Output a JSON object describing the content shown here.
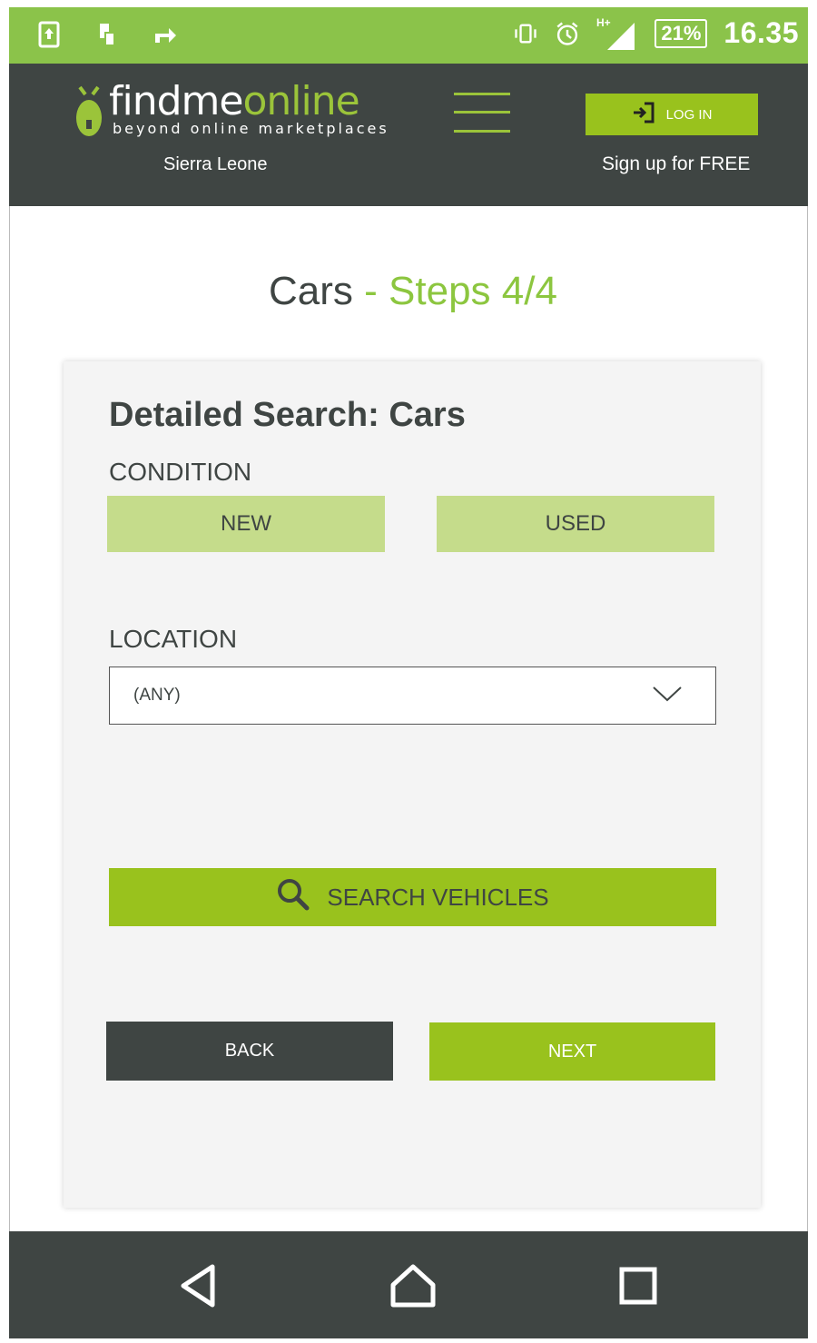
{
  "status_bar": {
    "battery": "21%",
    "time": "16.35",
    "network": "H+",
    "left_icons": [
      "screenshot-icon",
      "phone-transfer-icon",
      "forward-icon"
    ],
    "right_icons": [
      "vibrate-icon",
      "alarm-icon",
      "signal-icon"
    ]
  },
  "header": {
    "logo_text_part1": "findme",
    "logo_text_part2": "online",
    "logo_tagline": "beyond online marketplaces",
    "region": "Sierra Leone",
    "login_label": "LOG IN",
    "signup_label": "Sign up for FREE"
  },
  "page": {
    "title_main": "Cars",
    "title_accent": " - Steps 4/4"
  },
  "card": {
    "title": "Detailed Search: Cars",
    "condition_label": "CONDITION",
    "condition_options": [
      "NEW",
      "USED"
    ],
    "location_label": "LOCATION",
    "location_value": "(ANY)",
    "search_label": "SEARCH VEHICLES",
    "back_label": "BACK",
    "next_label": "NEXT"
  },
  "nav_bar": {
    "buttons": [
      "back-icon",
      "home-icon",
      "recents-icon"
    ]
  },
  "colors": {
    "status_green": "#8bc34a",
    "brand_green": "#99c21d",
    "light_green": "#c5dc8b",
    "dark": "#3f4543",
    "card_bg": "#f4f4f4"
  }
}
